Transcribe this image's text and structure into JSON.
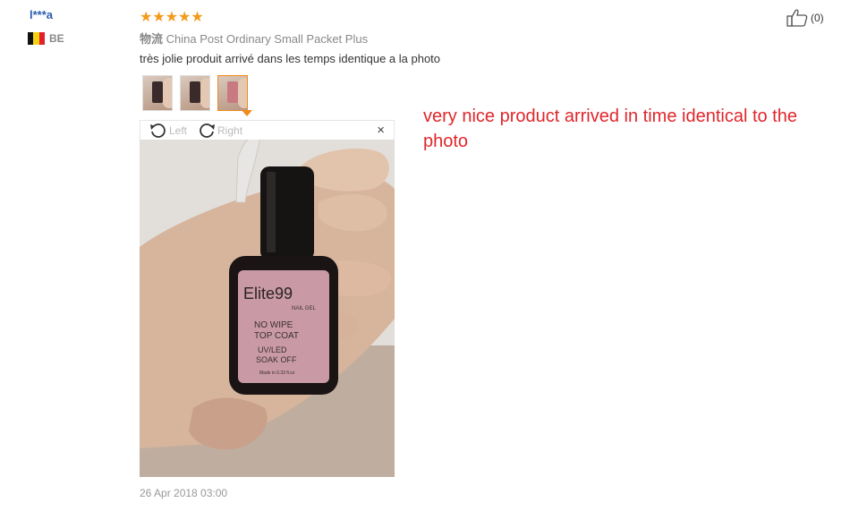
{
  "review": {
    "user_name": "l***a",
    "country_code": "BE",
    "flag_colors": [
      "#111111",
      "#f5d20f",
      "#e3202a"
    ],
    "stars": "★★★★★",
    "shipping_label": "物流",
    "shipping_method": "China Post Ordinary Small Packet Plus",
    "text": "très jolie produit arrivé dans les temps identique a la photo",
    "translation": "very nice product arrived in time identical to the photo",
    "date": "26 Apr 2018 03:00",
    "like_count": "(0)"
  },
  "viewer": {
    "rotate_left_label": "Left",
    "rotate_right_label": "Right",
    "close_symbol": "×"
  },
  "photo": {
    "label_brand": "Elite99",
    "label_sub": "NAIL GEL",
    "label_line1": "NO WIPE",
    "label_line2": "TOP COAT",
    "label_line3": "UV/LED",
    "label_line4": "SOAK OFF",
    "label_small": "Made in 0.33 fl.oz"
  },
  "colors": {
    "accent": "#f08a1c",
    "translation": "#e0262b",
    "username": "#2a5db0"
  }
}
